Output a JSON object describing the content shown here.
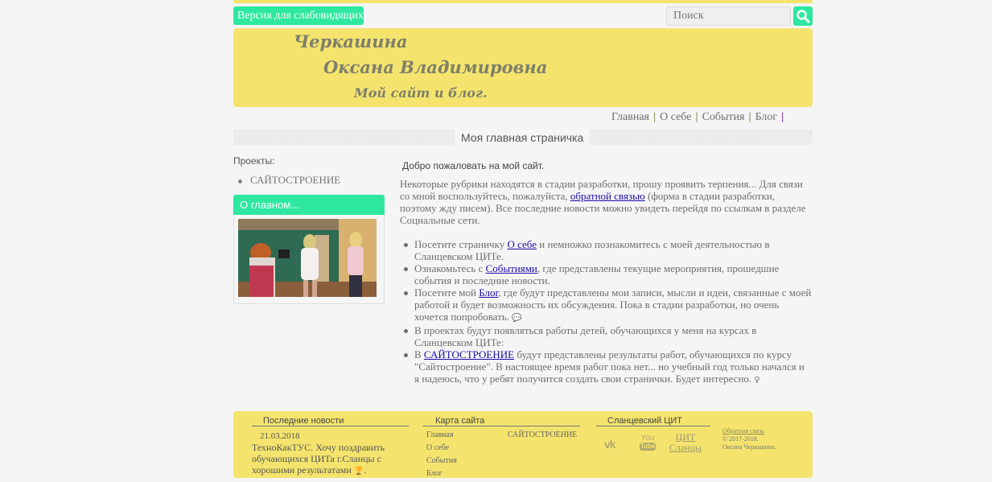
{
  "accessibility": {
    "label": "Версия для слабовидящих"
  },
  "search": {
    "placeholder": "Поиск"
  },
  "header": {
    "line1": "Черкашина",
    "line2": "Оксана Владимировна",
    "line3": "Мой сайт и блог."
  },
  "nav": {
    "items": [
      "Главная",
      "О себе",
      "События",
      "Блог"
    ],
    "separator": "|"
  },
  "page_title": "Моя главная страничка",
  "sidebar": {
    "projects_label": "Проекты:",
    "projects": [
      "САЙТОСТРОЕНИЕ"
    ],
    "about_title": "О главном..."
  },
  "content": {
    "welcome": "Добро пожаловать на мой сайт.",
    "intro": {
      "part1": "Некоторые рубрики находятся в стадии разработки, прошу проявить терпения... Для связи со мной воспользуйтесь, пожалуйста, ",
      "link": "обратной связью",
      "part2": " (форма в стадии разработки, поэтому жду писем). Все последние новости можно увидеть перейдя по ссылкам в разделе Социальные сети."
    },
    "bullets": [
      {
        "before": "Посетите страничку ",
        "link": "О себе",
        "after": " и немножко познакомитесь с моей деятельностью в Сланцевском ЦИТе."
      },
      {
        "before": "Ознакомьтесь с ",
        "link": "Событиями",
        "after": ", где представлены текущие мероприятия, прошедшие события и последние новости."
      },
      {
        "before": "Посетите мой ",
        "link": "Блог",
        "after": ", где будут представлены мои записи, мысли и идеи, связанные с моей работой и будет возможность их обсуждения. Пока в стадии разработки, но очень хочется попробовать. "
      },
      {
        "before": "В проектах будут появляться работы детей, обучающихся у меня на курсах в Сланцевском ЦИТе:",
        "link": "",
        "after": ""
      },
      {
        "before": "В ",
        "link": "САЙТОСТРОЕНИЕ",
        "after": " будут представлены результаты работ, обучающихся по курсу \"Сайтостроение\". В настоящее время работ пока нет... но учебный год только начался и я надеюсь, что у ребят получится создать свои странички. Будет интересно. "
      }
    ]
  },
  "footer": {
    "news_title": "Последние новости",
    "news_date": "21.03.2018",
    "news_text": "ТехноКакТУС. Хочу поздравить обучающихся ЦИТа г.Сланцы с хорошими результатами",
    "map_title": "Карта сайта",
    "map_links": [
      "Главная",
      "О себе",
      "События",
      "Блог"
    ],
    "map_projects": "САЙТОСТРОЕНИЕ",
    "cit_title": "Сланцевский ЦИТ",
    "vk": "vk",
    "youtube_top": "You",
    "youtube_bottom": "Tube",
    "cit_link": "ЦИТ Сланцы",
    "feedback": "Обратная связь",
    "copyright": "© 2017-2018.",
    "author": "Оксана Черкашина."
  },
  "colors": {
    "accent_green": "#2ee8a0",
    "header_yellow": "#f4e46e",
    "link_blue": "#1a0dab",
    "background": "#f5f5f5"
  }
}
